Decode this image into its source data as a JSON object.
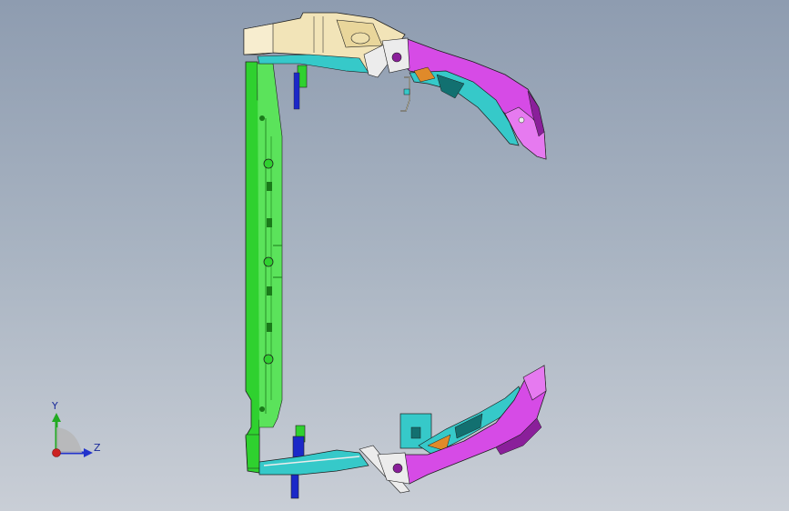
{
  "viewport": {
    "background_top": "#8e9cb0",
    "background_bottom": "#c9ced6"
  },
  "model": {
    "colors": {
      "green_frame": "#2fd12f",
      "green_dark": "#1a7a1a",
      "cream_bracket": "#f2e4b8",
      "magenta_fascia": "#d64be6",
      "magenta_dark": "#8a1f9a",
      "cyan_inner": "#36c9c9",
      "cyan_dark": "#127070",
      "white_plate": "#ececec",
      "blue_tab": "#1b28c8",
      "orange_part": "#e08a2a",
      "outline": "#1e1e1e"
    }
  },
  "triad": {
    "y_label": "Y",
    "z_label": "Z",
    "y_color": "#22aa22",
    "z_color": "#2233cc",
    "x_color": "#cc2222"
  }
}
